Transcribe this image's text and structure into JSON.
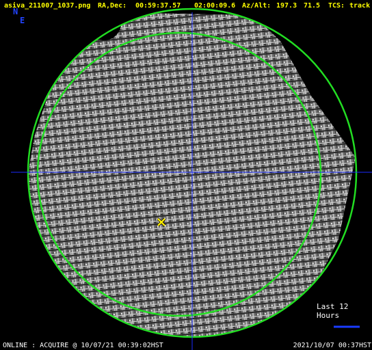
{
  "header": {
    "filename": "asiva_211007_1037.png",
    "radec_label": "RA,Dec:",
    "ra": "00:59:37.57",
    "dec": "02:00:09.6",
    "azalt_label": "Az/Alt:",
    "az": "197.3",
    "alt": "71.5",
    "tcs_label": "TCS:",
    "tcs_status": "track"
  },
  "compass": {
    "north": "N",
    "east": "E"
  },
  "legend": {
    "label": "Last 12 Hours"
  },
  "footer": {
    "status": "ONLINE : ACQUIRE @ 10/07/21 00:39:02HST",
    "timestamp": "2021/10/07 00:37HST"
  },
  "colors": {
    "header_text": "#ffff00",
    "compass": "#2244ff",
    "crosshair": "#1a2dff",
    "circles": "#22dd22",
    "marker": "#ffee00",
    "footer_text": "#ffffff",
    "track_line": "#1a3cff"
  },
  "icons": {
    "target": "x-marker-icon"
  }
}
